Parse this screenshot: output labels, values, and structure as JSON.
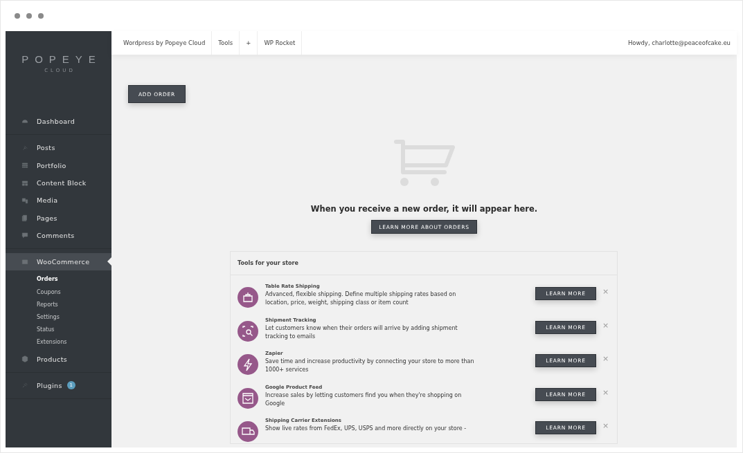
{
  "sidebar": {
    "logo": {
      "name": "POPEYE",
      "tagline": "CLOUD"
    },
    "groups": [
      [
        {
          "label": "Dashboard",
          "selected": false
        }
      ],
      [
        {
          "label": "Posts",
          "selected": false
        },
        {
          "label": "Portfolio",
          "selected": false
        },
        {
          "label": "Content Block",
          "selected": false
        },
        {
          "label": "Media",
          "selected": false
        },
        {
          "label": "Pages",
          "selected": false
        },
        {
          "label": "Comments",
          "selected": false
        }
      ],
      [
        {
          "label": "WooCommerce",
          "selected": true,
          "children": [
            {
              "label": "Orders",
              "selected": true
            },
            {
              "label": "Coupons",
              "selected": false
            },
            {
              "label": "Reports",
              "selected": false
            },
            {
              "label": "Settings",
              "selected": false
            },
            {
              "label": "Status",
              "selected": false
            },
            {
              "label": "Extensions",
              "selected": false
            }
          ]
        },
        {
          "label": "Products",
          "selected": false
        }
      ],
      [
        {
          "label": "Plugins",
          "selected": false,
          "badge": "1"
        }
      ]
    ]
  },
  "topbar": {
    "items": [
      "Wordpress by Popeye Cloud",
      "Tools",
      "+",
      "WP Rocket"
    ],
    "user": "Howdy, charlotte@peaceofcake.eu"
  },
  "add_button": "ADD ORDER",
  "empty_state": {
    "message": "When you receive a new order, it will appear here.",
    "button": "LEARN MORE ABOUT ORDERS"
  },
  "tools": {
    "title": "Tools for your store",
    "items": [
      {
        "name": "Table Rate Shipping",
        "description": "Advanced, flexible shipping. Define multiple shipping rates based on location, price, weight, shipping class or item count",
        "button": "LEARN MORE",
        "dismiss": "×"
      },
      {
        "name": "Shipment Tracking",
        "description": "Let customers know when their orders will arrive by adding shipment tracking to emails",
        "button": "LEARN MORE",
        "dismiss": "×"
      },
      {
        "name": "Zapier",
        "description": "Save time and increase productivity by connecting your store to more than 1000+ services",
        "button": "LEARN MORE",
        "dismiss": "×"
      },
      {
        "name": "Google Product Feed",
        "description": "Increase sales by letting customers find you when they're shopping on Google",
        "button": "LEARN MORE",
        "dismiss": "×"
      },
      {
        "name": "Shipping Carrier Extensions",
        "description": "Show live rates from FedEx, UPS, USPS and more directly on your store -",
        "button": "LEARN MORE",
        "dismiss": "×"
      }
    ]
  }
}
